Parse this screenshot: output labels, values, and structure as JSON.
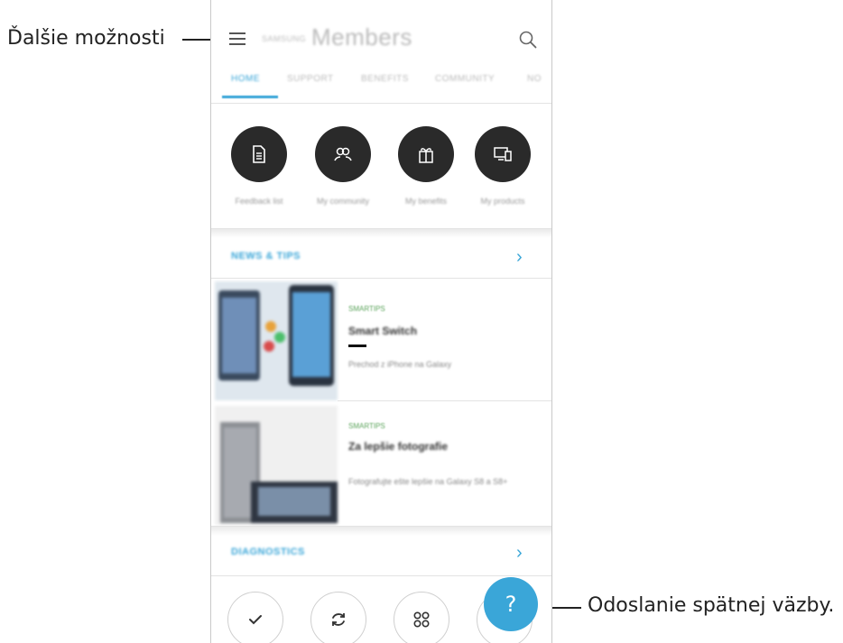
{
  "callouts": {
    "more_options": "Ďalšie možnosti",
    "send_feedback": "Odoslanie spätnej väzby."
  },
  "app": {
    "brand": "SAMSUNG",
    "title": "Members"
  },
  "tabs": [
    {
      "label": "HOME",
      "active": true
    },
    {
      "label": "SUPPORT",
      "active": false
    },
    {
      "label": "BENEFITS",
      "active": false
    },
    {
      "label": "COMMUNITY",
      "active": false
    },
    {
      "label": "NO",
      "active": false
    }
  ],
  "quick_actions": [
    {
      "label": "Feedback list",
      "icon": "document-icon"
    },
    {
      "label": "My community",
      "icon": "people-icon"
    },
    {
      "label": "My benefits",
      "icon": "gift-icon"
    },
    {
      "label": "My products",
      "icon": "devices-icon"
    }
  ],
  "news": {
    "section_title": "NEWS & TIPS",
    "cards": [
      {
        "tag": "SMARTIPS",
        "headline": "Smart Switch",
        "desc": "Prechod z iPhone na Galaxy"
      },
      {
        "tag": "SMARTIPS",
        "headline": "Za lepšie fotografie",
        "desc": "Fotografujte ešte lepšie na Galaxy S8 a S8+"
      }
    ]
  },
  "diagnostics": {
    "section_title": "DIAGNOSTICS"
  },
  "fab": {
    "label": "?"
  },
  "colors": {
    "accent": "#3aa6d8",
    "icon_circle": "#2a2a2a"
  }
}
